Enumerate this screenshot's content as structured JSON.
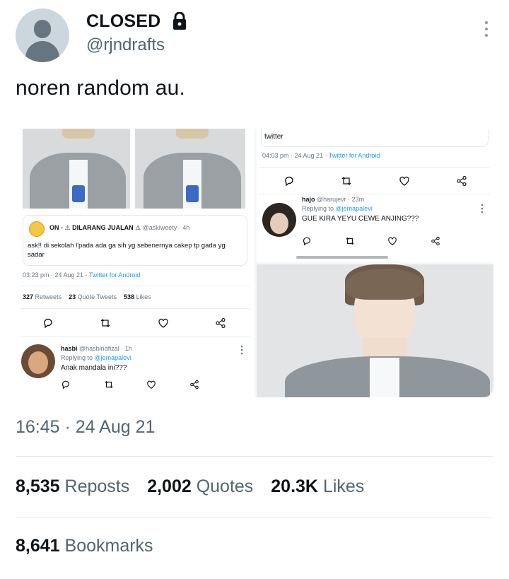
{
  "author": {
    "display_name": "CLOSED",
    "handle": "@rjndrafts",
    "locked": true
  },
  "tweet": {
    "text": "noren random au.",
    "timestamp": "16:45 · 24 Aug 21"
  },
  "stats": {
    "reposts_count": "8,535",
    "reposts_label": "Reposts",
    "quotes_count": "2,002",
    "quotes_label": "Quotes",
    "likes_count": "20.3K",
    "likes_label": "Likes",
    "bookmarks_count": "8,641",
    "bookmarks_label": "Bookmarks"
  },
  "media": {
    "left": {
      "quoted_name": "ON - ⚠ DILARANG JUALAN ⚠",
      "quoted_handle_time": "@askiweety · 4h",
      "quoted_text": "ask!! di sekolah l'pada ada ga sih yg sebenernya cakep tp gada yg sadar",
      "meta_time": "03:23 pm · 24 Aug 21 · ",
      "meta_app": "Twitter for Android",
      "retweets_num": "327",
      "retweets_lbl": "Retweets",
      "qt_num": "23",
      "qt_lbl": "Quote Tweets",
      "likes_num": "538",
      "likes_lbl": "Likes",
      "reply_name": "hasbi",
      "reply_handle_time": "@hasbinafizal · 1h",
      "reply_to_prefix": "Replying to ",
      "reply_to_mention": "@jemapalevi",
      "reply_text": "Anak mandala ini???"
    },
    "right_top": {
      "cut_text": "twitter",
      "meta_time": "04:03 pm · 24 Aug 21 · ",
      "meta_app": "Twitter for Android",
      "reply_name": "hajo",
      "reply_handle_time": "@harujevr · 23m",
      "reply_to_prefix": "Replying to ",
      "reply_to_mention": "@jemapalevi",
      "reply_text": "GUE KIRA YEYU CEWE ANJING???"
    }
  },
  "icons": [
    "lock-icon",
    "more-icon",
    "reply-icon",
    "retweet-icon",
    "like-icon",
    "share-icon"
  ],
  "colors": {
    "link": "#1d9bf0",
    "secondary_text": "#536471"
  }
}
